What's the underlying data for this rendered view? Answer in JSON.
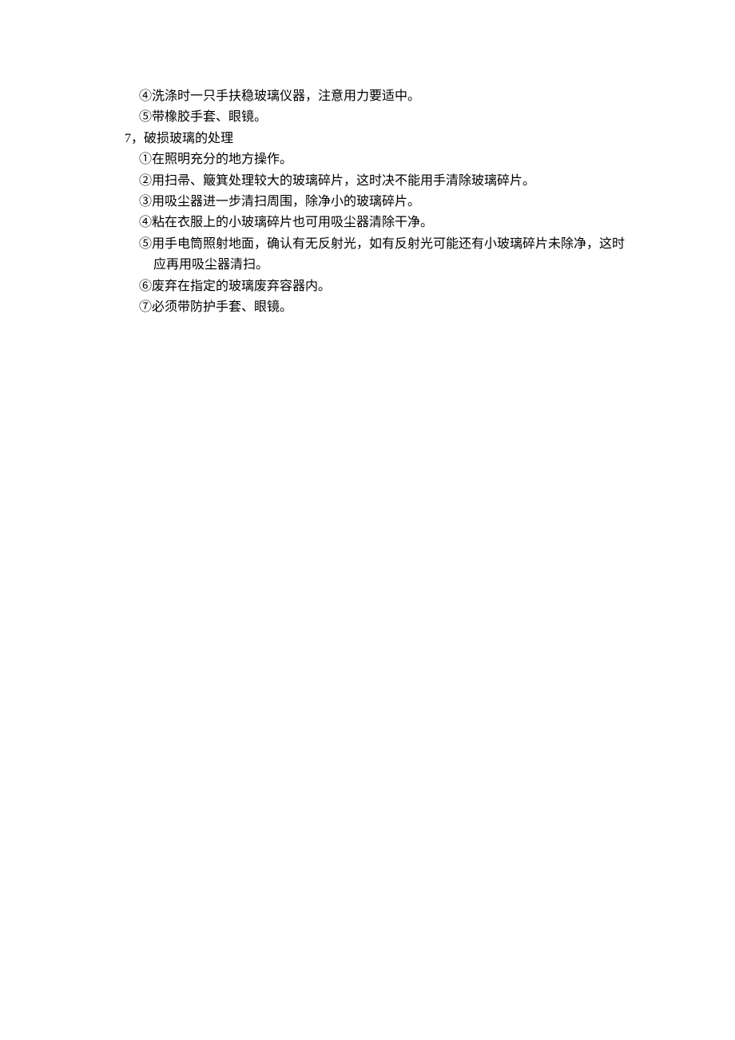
{
  "lines": [
    {
      "text": "④洗涤时一只手扶稳玻璃仪器，注意用力要适中。",
      "indent": "indent-0"
    },
    {
      "text": "⑤带橡胶手套、眼镜。",
      "indent": "indent-0"
    },
    {
      "text": "7，破损玻璃的处理",
      "indent": "indent-1"
    },
    {
      "text": "①在照明充分的地方操作。",
      "indent": "indent-2"
    },
    {
      "text": "②用扫帚、簸箕处理较大的玻璃碎片，这时决不能用手清除玻璃碎片。",
      "indent": "indent-2"
    },
    {
      "text": "③用吸尘器进一步清扫周围，除净小的玻璃碎片。",
      "indent": "indent-2"
    },
    {
      "text": "④粘在衣服上的小玻璃碎片也可用吸尘器清除干净。",
      "indent": "indent-2"
    },
    {
      "text": "⑤用手电筒照射地面，确认有无反射光，如有反射光可能还有小玻璃碎片未除净，这时",
      "indent": "indent-2"
    },
    {
      "text": "应再用吸尘器清扫。",
      "indent": "indent-3"
    },
    {
      "text": "⑥废弃在指定的玻璃废弃容器内。",
      "indent": "indent-2"
    },
    {
      "text": "⑦必须带防护手套、眼镜。",
      "indent": "indent-2"
    }
  ]
}
